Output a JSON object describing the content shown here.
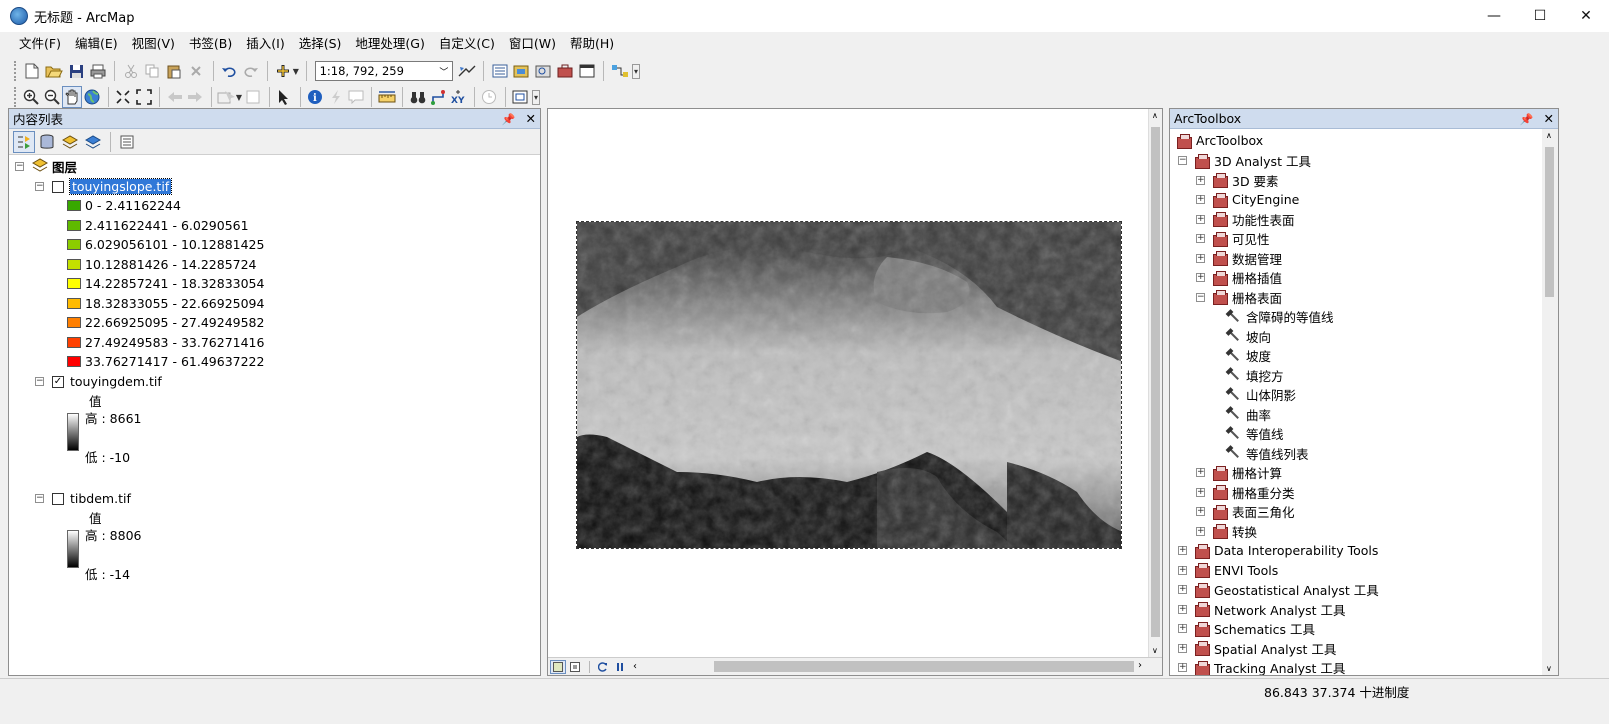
{
  "window": {
    "title": "无标题 - ArcMap",
    "minimize": "—",
    "maximize": "☐",
    "close": "✕"
  },
  "menu": [
    "文件(F)",
    "编辑(E)",
    "视图(V)",
    "书签(B)",
    "插入(I)",
    "选择(S)",
    "地理处理(G)",
    "自定义(C)",
    "窗口(W)",
    "帮助(H)"
  ],
  "toolbar": {
    "scale": "1:18, 792, 259"
  },
  "toc": {
    "title": "内容列表",
    "root": "图层",
    "layers": [
      {
        "name": "touyingslope.tif",
        "checked": false,
        "classes": [
          {
            "label": "0 - 2.41162244",
            "color": "#38a800"
          },
          {
            "label": "2.411622441 - 6.0290561",
            "color": "#5fba00"
          },
          {
            "label": "6.029056101 - 10.12881425",
            "color": "#8ccc00"
          },
          {
            "label": "10.12881426 - 14.2285724",
            "color": "#c3e000"
          },
          {
            "label": "14.22857241 - 18.32833054",
            "color": "#ffff00"
          },
          {
            "label": "18.32833055 - 22.66925094",
            "color": "#ffbb00"
          },
          {
            "label": "22.66925095 - 27.49249582",
            "color": "#ff7f00"
          },
          {
            "label": "27.49249583 - 33.76271416",
            "color": "#ff4000"
          },
          {
            "label": "33.76271417 - 61.49637222",
            "color": "#ff0000"
          }
        ]
      },
      {
        "name": "touyingdem.tif",
        "checked": true,
        "value_label": "值",
        "high": "高 : 8661",
        "low": "低 : -10"
      },
      {
        "name": "tibdem.tif",
        "checked": false,
        "value_label": "值",
        "high": "高 : 8806",
        "low": "低 : -14"
      }
    ]
  },
  "arctoolbox": {
    "title": "ArcToolbox",
    "root": "ArcToolbox",
    "items": [
      {
        "label": "3D Analyst 工具",
        "level": 1,
        "type": "toolbox",
        "expanded": true
      },
      {
        "label": "3D 要素",
        "level": 2,
        "type": "toolset",
        "expanded": false
      },
      {
        "label": "CityEngine",
        "level": 2,
        "type": "toolset",
        "expanded": false
      },
      {
        "label": "功能性表面",
        "level": 2,
        "type": "toolset",
        "expanded": false
      },
      {
        "label": "可见性",
        "level": 2,
        "type": "toolset",
        "expanded": false
      },
      {
        "label": "数据管理",
        "level": 2,
        "type": "toolset",
        "expanded": false
      },
      {
        "label": "栅格插值",
        "level": 2,
        "type": "toolset",
        "expanded": false
      },
      {
        "label": "栅格表面",
        "level": 2,
        "type": "toolset",
        "expanded": true
      },
      {
        "label": "含障碍的等值线",
        "level": 3,
        "type": "tool"
      },
      {
        "label": "坡向",
        "level": 3,
        "type": "tool"
      },
      {
        "label": "坡度",
        "level": 3,
        "type": "tool"
      },
      {
        "label": "填挖方",
        "level": 3,
        "type": "tool"
      },
      {
        "label": "山体阴影",
        "level": 3,
        "type": "tool"
      },
      {
        "label": "曲率",
        "level": 3,
        "type": "tool"
      },
      {
        "label": "等值线",
        "level": 3,
        "type": "tool"
      },
      {
        "label": "等值线列表",
        "level": 3,
        "type": "tool"
      },
      {
        "label": "栅格计算",
        "level": 2,
        "type": "toolset",
        "expanded": false
      },
      {
        "label": "栅格重分类",
        "level": 2,
        "type": "toolset",
        "expanded": false
      },
      {
        "label": "表面三角化",
        "level": 2,
        "type": "toolset",
        "expanded": false
      },
      {
        "label": "转换",
        "level": 2,
        "type": "toolset",
        "expanded": false
      },
      {
        "label": "Data Interoperability Tools",
        "level": 1,
        "type": "toolbox",
        "expanded": false
      },
      {
        "label": "ENVI Tools",
        "level": 1,
        "type": "toolbox",
        "expanded": false
      },
      {
        "label": "Geostatistical Analyst 工具",
        "level": 1,
        "type": "toolbox",
        "expanded": false
      },
      {
        "label": "Network Analyst 工具",
        "level": 1,
        "type": "toolbox",
        "expanded": false
      },
      {
        "label": "Schematics 工具",
        "level": 1,
        "type": "toolbox",
        "expanded": false
      },
      {
        "label": "Spatial Analyst 工具",
        "level": 1,
        "type": "toolbox",
        "expanded": false
      },
      {
        "label": "Tracking Analyst 工具",
        "level": 1,
        "type": "toolbox",
        "expanded": false
      }
    ]
  },
  "status": {
    "coordinates": "86.843  37.374 十进制度"
  }
}
